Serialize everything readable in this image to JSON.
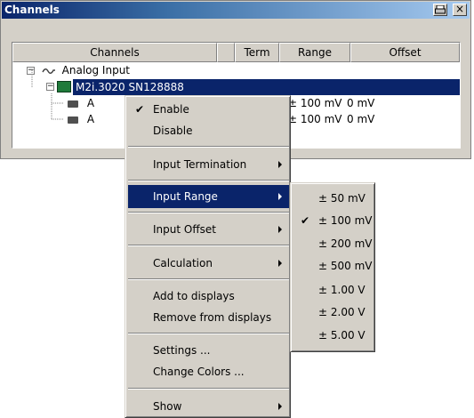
{
  "window": {
    "title": "Channels",
    "icon_name": "printer-icon",
    "close_glyph": "×"
  },
  "table": {
    "headers": [
      "Channels",
      "",
      "Term",
      "Range",
      "Offset"
    ]
  },
  "tree": {
    "root_label": "Analog Input",
    "device_label": "M2i.3020 SN128888",
    "channels": [
      {
        "label": "A",
        "range": "± 100 mV",
        "offset": "0 mV"
      },
      {
        "label": "A",
        "range": "± 100 mV",
        "offset": "0 mV"
      }
    ]
  },
  "context_menu": {
    "enable": "Enable",
    "disable": "Disable",
    "input_termination": "Input Termination",
    "input_range": "Input Range",
    "input_offset": "Input Offset",
    "calculation": "Calculation",
    "add_to_displays": "Add to displays",
    "remove_from_displays": "Remove from displays",
    "settings": "Settings ...",
    "change_colors": "Change Colors ...",
    "show": "Show",
    "checked_item": "Enable"
  },
  "range_submenu": {
    "items": [
      "± 50 mV",
      "± 100 mV",
      "± 200 mV",
      "± 500 mV",
      "± 1.00 V",
      "± 2.00 V",
      "± 5.00 V"
    ],
    "checked": "± 100 mV"
  },
  "colors": {
    "selection": "#0a246a",
    "face": "#d4d0c8",
    "channel_icon": "#1f7a3a"
  }
}
